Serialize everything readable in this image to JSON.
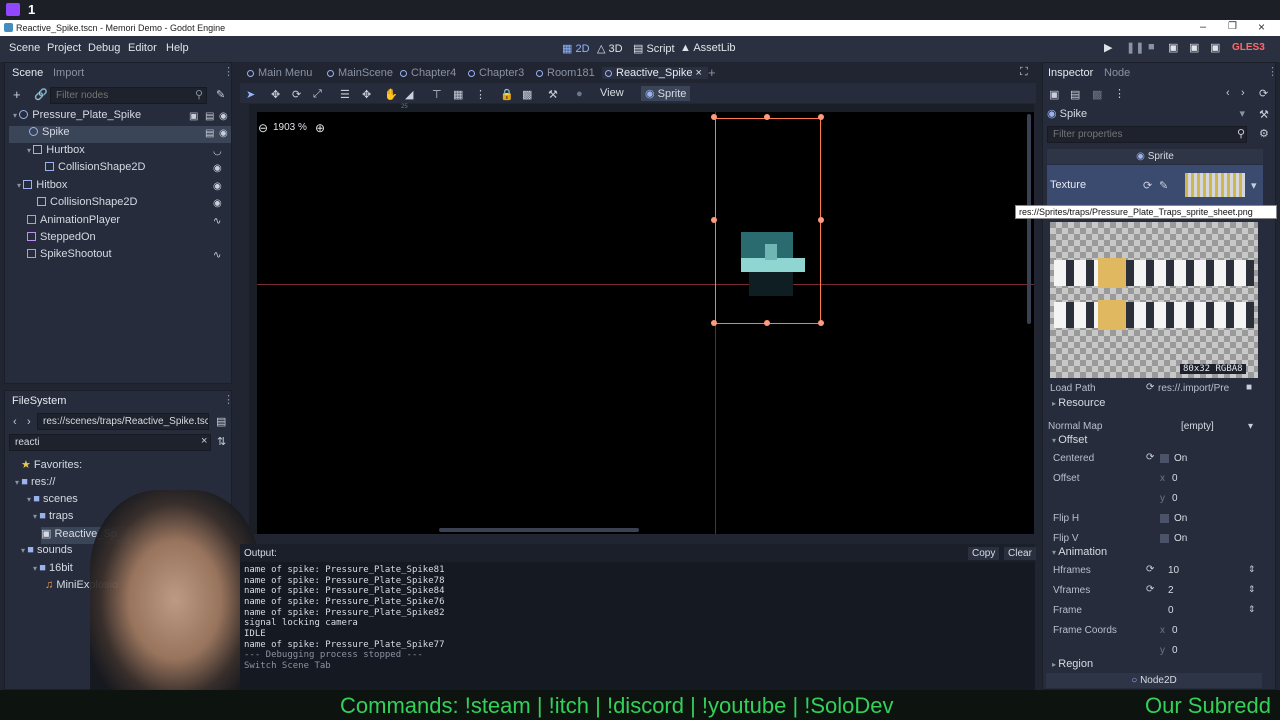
{
  "twitch": {
    "counter": "1"
  },
  "window": {
    "title": "Reactive_Spike.tscn - Memori Demo - Godot Engine"
  },
  "menu": {
    "items": [
      "Scene",
      "Project",
      "Debug",
      "Editor",
      "Help"
    ]
  },
  "workspaces": {
    "items": [
      "2D",
      "3D",
      "Script",
      "AssetLib"
    ]
  },
  "renderer": "GLES3",
  "scene_dock": {
    "tabs": [
      "Scene",
      "Import"
    ],
    "filter_placeholder": "Filter nodes",
    "nodes": [
      {
        "label": "Pressure_Plate_Spike",
        "depth": 0
      },
      {
        "label": "Spike",
        "depth": 1
      },
      {
        "label": "Hurtbox",
        "depth": 1
      },
      {
        "label": "CollisionShape2D",
        "depth": 2
      },
      {
        "label": "Hitbox",
        "depth": 1
      },
      {
        "label": "CollisionShape2D",
        "depth": 2
      },
      {
        "label": "AnimationPlayer",
        "depth": 1
      },
      {
        "label": "SteppedOn",
        "depth": 1
      },
      {
        "label": "SpikeShootout",
        "depth": 1
      }
    ]
  },
  "filesystem": {
    "title": "FileSystem",
    "path": "res://scenes/traps/Reactive_Spike.tsc",
    "search": "reacti",
    "tree": [
      "Favorites:",
      "res://",
      "scenes",
      "traps",
      "Reactive_Sp",
      "sounds",
      "16bit",
      "MiniExplosio"
    ]
  },
  "editor_tabs": [
    "Main Menu",
    "MainScene",
    "Chapter4",
    "Chapter3",
    "Room181",
    "Reactive_Spike"
  ],
  "toolbar": {
    "view": "View",
    "sprite": "Sprite"
  },
  "viewport": {
    "zoom": "1903 %",
    "ruler_mark": "25"
  },
  "output": {
    "title": "Output:",
    "copy": "Copy",
    "clear": "Clear",
    "lines": [
      "name of spike: Pressure_Plate_Spike81",
      "name of spike: Pressure_Plate_Spike78",
      "name of spike: Pressure_Plate_Spike84",
      "name of spike: Pressure_Plate_Spike76",
      "name of spike: Pressure_Plate_Spike82",
      "signal locking camera",
      "IDLE",
      "name of spike: Pressure_Plate_Spike77",
      "--- Debugging process stopped ---",
      "Switch Scene Tab"
    ]
  },
  "inspector": {
    "tabs": [
      "Inspector",
      "Node"
    ],
    "object": "Spike",
    "filter_placeholder": "Filter properties",
    "class": "Sprite",
    "texture_label": "Texture",
    "tooltip": "res://Sprites/traps/Pressure_Plate_Traps_sprite_sheet.png",
    "texture_info": "80x32 RGBA8",
    "load_path_label": "Load Path",
    "load_path_value": "res://.import/Pre",
    "resource": "Resource",
    "normal_map_label": "Normal Map",
    "normal_map_value": "[empty]",
    "offset_section": "Offset",
    "centered_label": "Centered",
    "on": "On",
    "offset_label": "Offset",
    "x": "x",
    "y": "y",
    "offset_x": "0",
    "offset_y": "0",
    "flip_h": "Flip H",
    "flip_v": "Flip V",
    "animation_section": "Animation",
    "hframes_label": "Hframes",
    "hframes": "10",
    "vframes_label": "Vframes",
    "vframes": "2",
    "frame_label": "Frame",
    "frame": "0",
    "frame_coords_label": "Frame Coords",
    "fc_x": "0",
    "fc_y": "0",
    "region": "Region",
    "node2d": "Node2D"
  },
  "ticker": {
    "left": "Commands: !steam | !itch | !discord | !youtube | !SoloDev",
    "right": "Our Subredd"
  },
  "colors": {
    "accent": "#699ce8",
    "selection_outline": "#ff7a4d",
    "ticker_text": "#33d05a"
  }
}
